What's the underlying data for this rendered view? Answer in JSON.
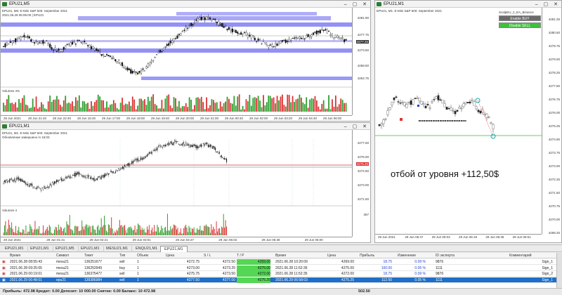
{
  "windows": {
    "top_left": {
      "title": "EPU21,M5",
      "header_line1": "EPU21, M5: E-Mini S&P 500: September 2021",
      "header_line2": "2021.06.29 06:05:00 | EPU21",
      "volume_label": "Volumes 4%",
      "prices": [
        "4281.90",
        "4277.75",
        "4273.50",
        "4269.50",
        "4264.75",
        "4260.50"
      ],
      "current_price": "4277.25",
      "times": [
        "28 Jun 2021",
        "28 Jun 21:40",
        "28 Jun 22:40",
        "28 Jun 15:40",
        "29 Jun 17:00",
        "29 Jun 18:00",
        "29 Jun 19:40",
        "29 Jun 20:00",
        "29 Jun 21:00",
        "29 Jun 00:40",
        "29 Jun 02:00",
        "29 Jun 03:20",
        "29 Jun 04:40",
        "29 Jun 06:00"
      ]
    },
    "bottom_left": {
      "title": "EPU21,M1",
      "header_line1": "EPU21, M1: E-Mini S&P 500: September 2021",
      "header_line2": "Обновление завершено in 16:03",
      "volume_label": "Volumes 4",
      "prices": [
        "4277.50",
        "4276.00",
        "4274.50",
        "4273.00",
        "4271.50"
      ],
      "current_price": "4275.25",
      "volume_max": "367",
      "times": [
        "29 Jun 2021",
        "29 Jun 01:41",
        "29 Jun 02:21",
        "29 Jun 03:01",
        "29 Jun 04:27",
        "29 Jun 05:02",
        "29 Jun 05:38",
        "29 Jun 06:00"
      ]
    },
    "right": {
      "title": "EPU21,M1",
      "header_line1": "EPU21, M1: E-Mini S&P 500: September 2021",
      "ea_name": "ScalpEU_2_EA_Binance",
      "btn_buy": "Enable BUY",
      "btn_sell": "Disable SELL",
      "prices": [
        "4281.25",
        "4280.50",
        "4279.75",
        "4279.00",
        "4278.25",
        "4277.50",
        "4276.75",
        "4276.00",
        "4275.25",
        "4274.50",
        "4273.75",
        "4273.00",
        "4272.25",
        "4271.50",
        "4270.75",
        "4270.00",
        "4269.25"
      ],
      "current_price": "4275.25",
      "times": [
        "29 Jun 2021",
        "29 Jun 05:47",
        "29 Jun 06:03",
        "29 Jun 06:19",
        "29 Jun 06:35",
        "29 Jun 06:51"
      ],
      "annotation": "отбой от уровня +112,50$"
    }
  },
  "tabs": [
    "EPU21,M1",
    "EPU21,M1",
    "EPU21,M5",
    "EPU21,M1",
    "MESU21,M1",
    "ENQU21,M1",
    "EPU21,M1"
  ],
  "active_tab": 6,
  "table": {
    "columns": [
      "Время",
      "Символ",
      "Тикет",
      "Тип",
      "Объем",
      "Цена",
      "S / L",
      "T / P",
      "Время",
      "Цена",
      "Прибыль",
      "Изменение",
      "ID эксперта",
      "Комментарий"
    ],
    "rows": [
      [
        "2021.06.28 08:55:43",
        "mesu21",
        "136251677",
        "sell",
        "1",
        "4272.75",
        "4272.50",
        "4269.00",
        "2021.06.28 10:20:09",
        "4269.00",
        "18.75",
        "0.09 %",
        "9876",
        "Sign_1"
      ],
      [
        "2021.06.28 09:25:05",
        "mesu21",
        "136252949",
        "buy",
        "1",
        "4273.00",
        "4273.25",
        "4275.00",
        "2021.06.28 11:52:35",
        "4275.00",
        "100.00",
        "0.05 %",
        "1111",
        "Sign_1"
      ],
      [
        "2021.06.29 00:19:01",
        "mesu21",
        "136375477",
        "sell",
        "1",
        "4275.75",
        "4273.50",
        "4272.00",
        "2021.06.28 11:52:35",
        "4272.00",
        "18.75",
        "0.09 %",
        "9876",
        "Sign_2"
      ],
      [
        "2021.06.29 06:48:01",
        "epu21",
        "139386984",
        "sell",
        "1",
        "4277.50",
        "4277.00",
        "4275.25",
        "2021.06.29 06:58:03",
        "4275.25",
        "112.50",
        "0.05 %",
        "1111",
        "Sign_1"
      ]
    ],
    "selected_row": 3
  },
  "summary": {
    "text": "Прибыль: 472.98  Кредит: 0.00  Депозит: 10 000.00  Снятие: 0.00  Баланс: 10 472.98",
    "total_profit": "502.50"
  },
  "colors": {
    "bull": "#2e7d32",
    "level_band": "#6f6cf2",
    "vol_green": "#2e9e2e",
    "vol_red": "#d33",
    "selection": "#1e6fc9",
    "tp_green": "#55d655"
  }
}
